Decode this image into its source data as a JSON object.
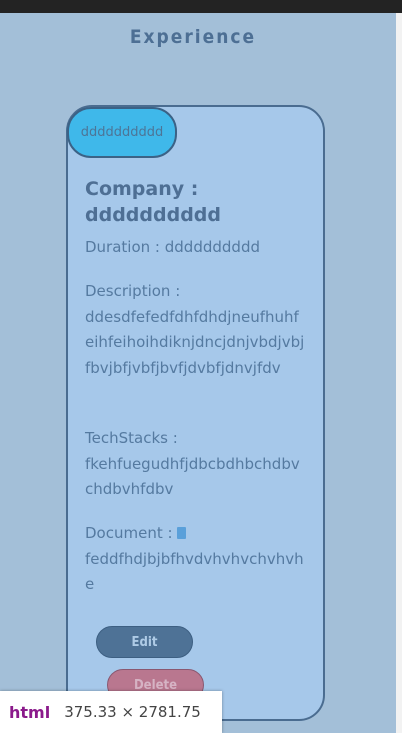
{
  "section": {
    "heading": "Experience"
  },
  "card": {
    "badge": "dddddddddd",
    "company_label": "Company :",
    "company_value": "dddddddddd",
    "duration_label": "Duration :",
    "duration_value": "dddddddddd",
    "description_label": "Description :",
    "description_value": "ddesdfefedfdhfdhdjneufhuhfeihfeihoihdiknjdncjdnjvbdjvbjfbvjbfjvbfjbvfjdvbfjdnvjfdv",
    "techstacks_label": "TechStacks :",
    "techstacks_value": "fkehfuegudhfjdbcbdhbchdbvchdbvhfdbv",
    "document_label": "Document :",
    "document_icon": "document-icon",
    "document_value": "feddfhdjbjbfhvdvhvhvchvhvhe",
    "edit_label": "Edit",
    "delete_label": "Delete"
  },
  "devtools": {
    "tag": "html",
    "size": "375.33 × 2781.75"
  }
}
